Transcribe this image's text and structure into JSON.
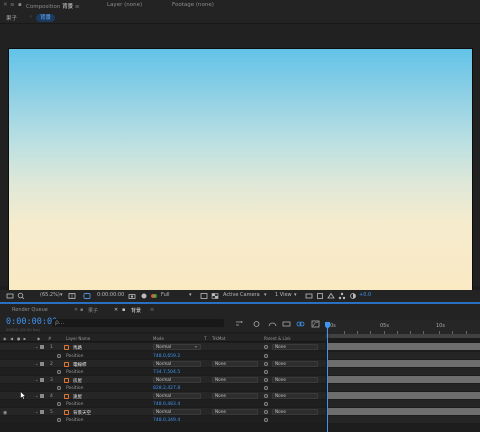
{
  "top_tabs": {
    "composition_label": "Composition",
    "composition_name": "背景",
    "layer_label": "Layer (none)",
    "footage_label": "Footage (none)"
  },
  "comp_nav": {
    "parent": "果子",
    "current": "背景"
  },
  "viewer_bar": {
    "zoom": "(65.2%)",
    "timecode": "0:00:00:00",
    "resolution": "Full",
    "camera": "Active Camera",
    "view": "1 View",
    "exposure": "+0.0"
  },
  "timeline_tabs": {
    "render_queue": "Render Queue",
    "tab1": "果子",
    "tab2": "背景"
  },
  "timeline": {
    "timecode": "0:00:00:00",
    "fps": "00000 (25.00 fps)",
    "search_placeholder": "ρ..."
  },
  "columns": {
    "layer_name": "Layer Name",
    "mode": "Mode",
    "t": "T",
    "trkmat": "TrkMat",
    "parent": "Parent & Link"
  },
  "ruler": {
    "labels": [
      "0s",
      "05s",
      "10s"
    ]
  },
  "layers": [
    {
      "num": "1",
      "name": "馬路",
      "mode": "Normal",
      "trkmat": "",
      "parent": "None",
      "position": "748.0,659.2"
    },
    {
      "num": "2",
      "name": "電線桿",
      "mode": "Normal",
      "trkmat": "None",
      "parent": "None",
      "position": "734.7,504.5"
    },
    {
      "num": "3",
      "name": "房屋",
      "mode": "Normal",
      "trkmat": "None",
      "parent": "None",
      "position": "828.2,427.8"
    },
    {
      "num": "4",
      "name": "遠屋",
      "mode": "Normal",
      "trkmat": "None",
      "parent": "None",
      "position": "748.0,483.4"
    },
    {
      "num": "5",
      "name": "背景天空",
      "mode": "Normal",
      "trkmat": "None",
      "parent": "None",
      "position": "748.0,349.4"
    }
  ],
  "property_label": "Position",
  "colors": {
    "accent_blue": "#3e95f2",
    "sky_top": "#62c3e8",
    "sky_bottom": "#faeac4",
    "panel_bg": "#1d1d1d"
  }
}
